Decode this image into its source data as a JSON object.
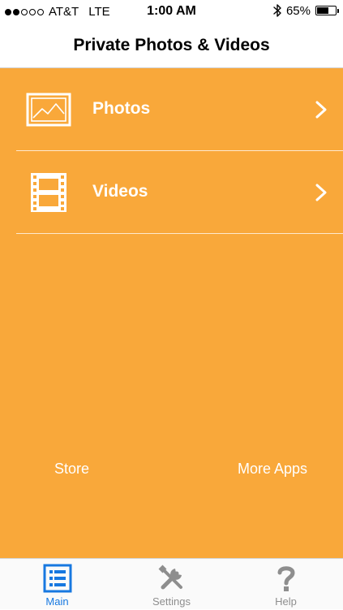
{
  "status_bar": {
    "carrier": "AT&T",
    "network": "LTE",
    "time": "1:00 AM",
    "battery_percent_text": "65%",
    "battery_level": 0.65,
    "signal_bars_filled": 2,
    "signal_bars_total": 5
  },
  "nav": {
    "title": "Private Photos & Videos"
  },
  "menu": {
    "photos_label": "Photos",
    "videos_label": "Videos"
  },
  "links": {
    "store_label": "Store",
    "more_apps_label": "More Apps"
  },
  "tab_bar": {
    "main_label": "Main",
    "settings_label": "Settings",
    "help_label": "Help",
    "active_tab": "Main"
  },
  "colors": {
    "accent": "#f9a83a",
    "active_tab": "#1778e0",
    "inactive_tab": "#8e8e8e"
  },
  "icons": {
    "photos": "picture-frame-icon",
    "videos": "film-strip-icon",
    "chevron": "chevron-right-icon",
    "main": "list-grid-icon",
    "settings": "wrench-screwdriver-icon",
    "help": "question-mark-icon",
    "bluetooth": "bluetooth-icon",
    "battery": "battery-icon"
  }
}
